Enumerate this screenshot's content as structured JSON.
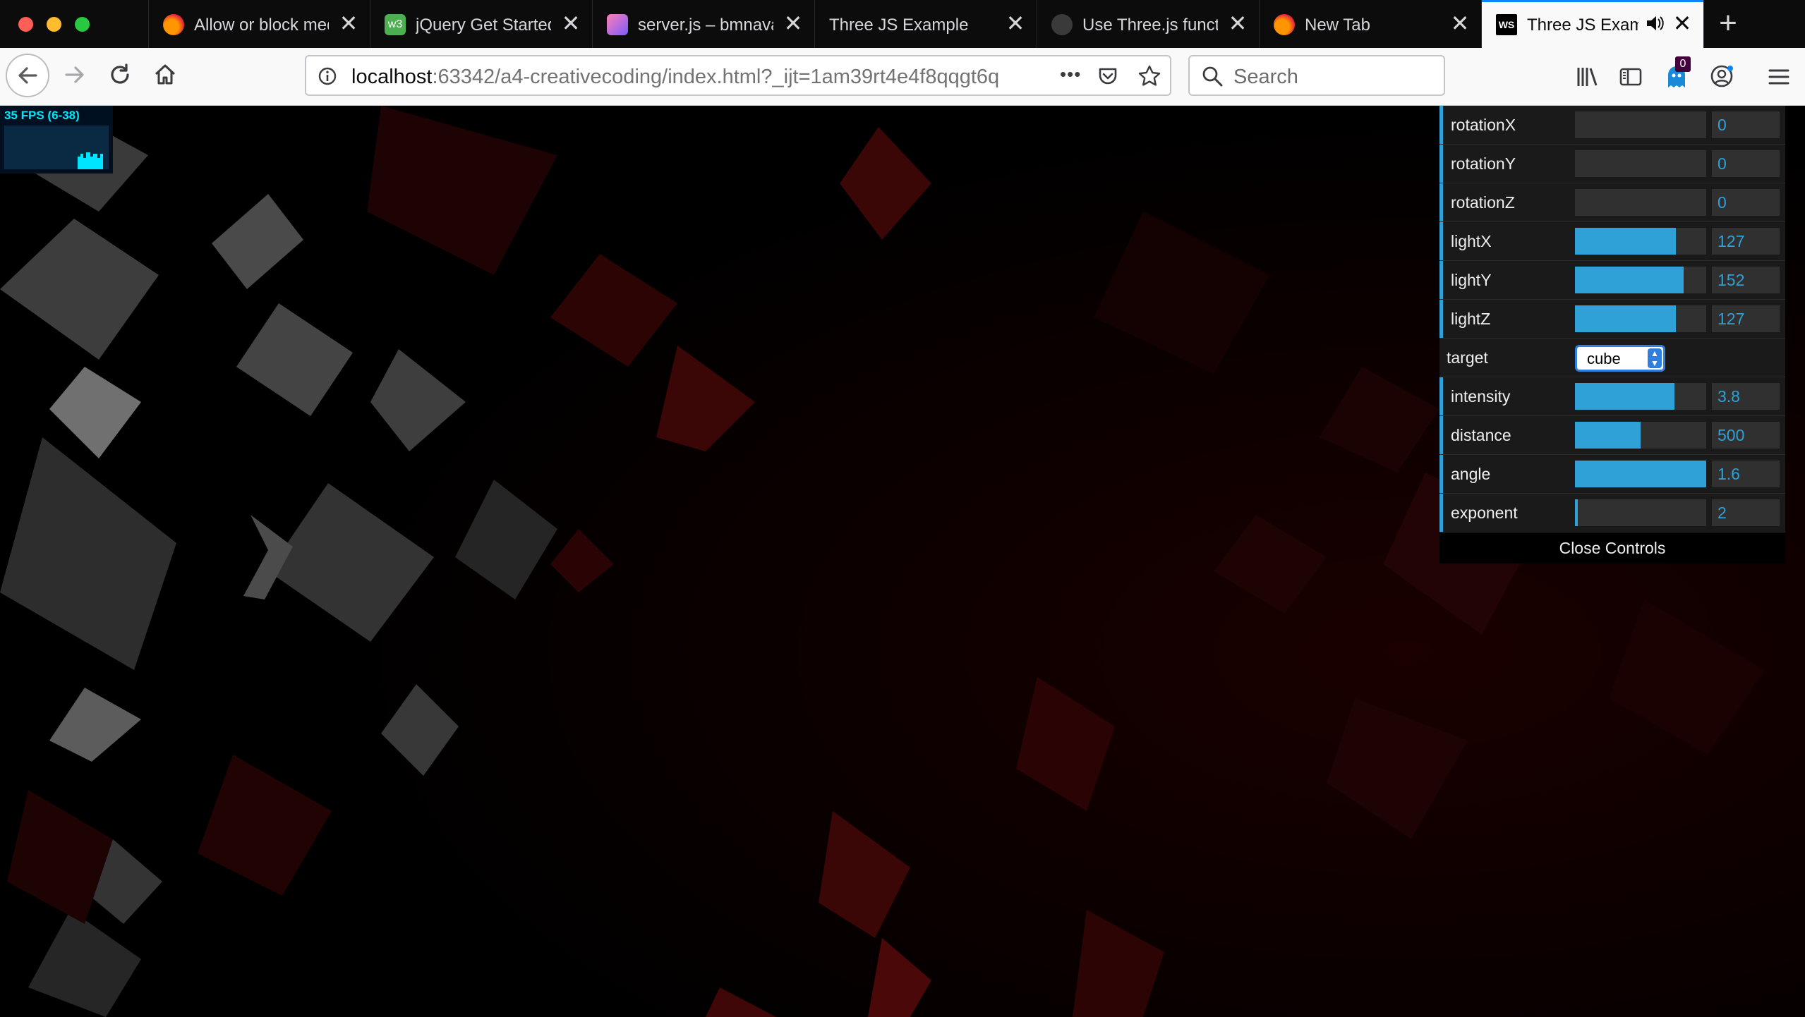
{
  "window_controls": {
    "close_color": "#ff5f57",
    "minimize_color": "#febc2e",
    "zoom_color": "#28c840"
  },
  "tabs": [
    {
      "title": "Allow or block med",
      "icon": "firefox-icon",
      "active": false
    },
    {
      "title": "jQuery Get Started",
      "icon": "w3schools-icon",
      "active": false
    },
    {
      "title": "server.js – bmnava",
      "icon": "glitch-icon",
      "active": false
    },
    {
      "title": "Three JS Example",
      "icon": "",
      "active": false
    },
    {
      "title": "Use Three.js functi",
      "icon": "github-icon",
      "active": false
    },
    {
      "title": "New Tab",
      "icon": "firefox-icon",
      "active": false
    },
    {
      "title": "Three JS Examp",
      "icon": "webstorm-icon",
      "active": true,
      "audio": true
    }
  ],
  "tab_close_glyph": "✕",
  "new_tab_glyph": "+",
  "nav": {
    "url_host": "localhost",
    "url_rest": ":63342/a4-creativecoding/index.html?_ijt=1am39rt4e4f8qqgt6q",
    "search_placeholder": "Search",
    "more_glyph": "•••",
    "notification_count": "0"
  },
  "stats": {
    "fps_text": "35 FPS (6-38)"
  },
  "gui": {
    "sliders_top": [
      {
        "label": "rotationX",
        "value": "0",
        "fill": 0.0
      },
      {
        "label": "rotationY",
        "value": "0",
        "fill": 0.0
      },
      {
        "label": "rotationZ",
        "value": "0",
        "fill": 0.0
      },
      {
        "label": "lightX",
        "value": "127",
        "fill": 0.77
      },
      {
        "label": "lightY",
        "value": "152",
        "fill": 0.83
      },
      {
        "label": "lightZ",
        "value": "127",
        "fill": 0.77
      }
    ],
    "target": {
      "label": "target",
      "value": "cube"
    },
    "sliders_bottom": [
      {
        "label": "intensity",
        "value": "3.8",
        "fill": 0.76
      },
      {
        "label": "distance",
        "value": "500",
        "fill": 0.5
      },
      {
        "label": "angle",
        "value": "1.6",
        "fill": 1.0
      },
      {
        "label": "exponent",
        "value": "2",
        "fill": 0.02
      }
    ],
    "close_label": "Close Controls"
  },
  "colors": {
    "accent": "#2fa1d6",
    "gui_bg": "#1a1a1a",
    "tab_active": "#f9f9fa"
  }
}
